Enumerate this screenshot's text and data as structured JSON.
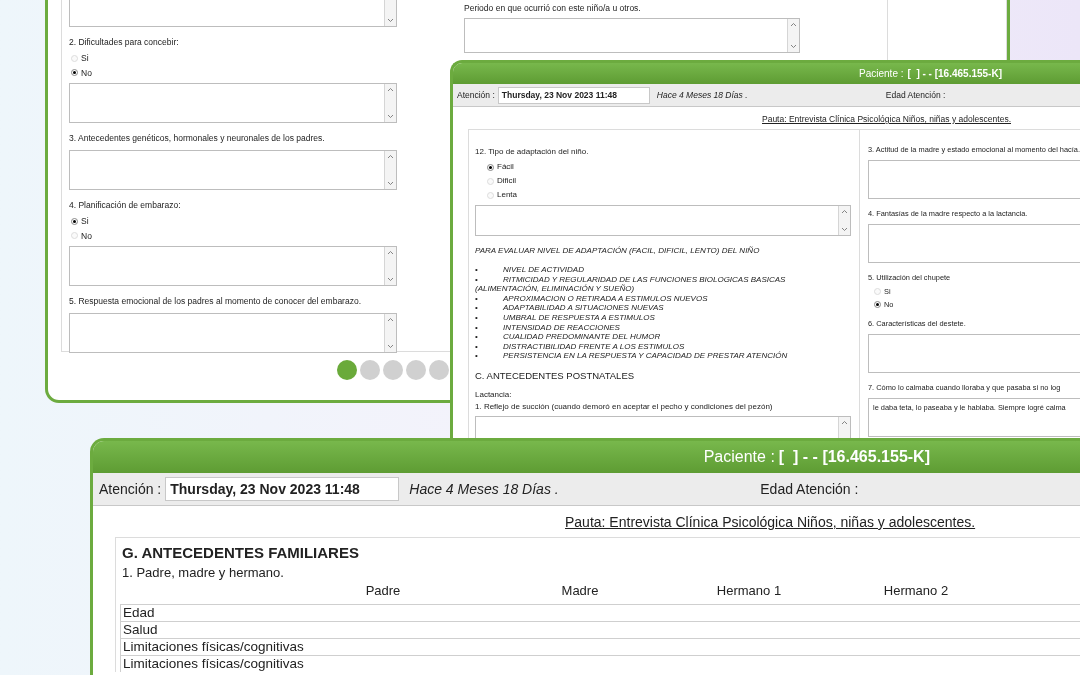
{
  "back_window": {
    "left_column": [
      {
        "kind": "textarea"
      },
      {
        "kind": "question",
        "text": "2. Dificultades para concebir:"
      },
      {
        "kind": "radio",
        "label": "Si",
        "selected": false
      },
      {
        "kind": "radio",
        "label": "No",
        "selected": true
      },
      {
        "kind": "textarea"
      },
      {
        "kind": "question",
        "text": "3. Antecedentes genéticos, hormonales y neuronales de los padres."
      },
      {
        "kind": "textarea"
      },
      {
        "kind": "question",
        "text": "4. Planificación de embarazo:"
      },
      {
        "kind": "radio",
        "label": "Si",
        "selected": true
      },
      {
        "kind": "radio",
        "label": "No",
        "selected": false
      },
      {
        "kind": "textarea"
      },
      {
        "kind": "question",
        "text": "5. Respuesta emocional de los padres  al momento de conocer del embarazo."
      },
      {
        "kind": "textarea"
      }
    ],
    "right_column": [
      {
        "kind": "question",
        "text": "Periodo en que ocurrió con este niño/a u otros."
      },
      {
        "kind": "textarea"
      }
    ],
    "pager": [
      {
        "selected": true
      },
      {
        "selected": false
      },
      {
        "selected": false
      },
      {
        "selected": false
      },
      {
        "selected": false
      }
    ]
  },
  "middle_window": {
    "header": {
      "label": "Paciente :",
      "value": "[  ] - - [16.465.155-K]"
    },
    "attention": {
      "label": "Atención :",
      "value": "Thursday, 23 Nov 2023 11:48",
      "elapsed": "Hace 4 Meses 18 Días .",
      "age_label": "Edad Atención :"
    },
    "pauta": "Pauta: Entrevista Clínica Psicológica Niños, niñas y adolescentes.",
    "left_column": [
      {
        "kind": "question",
        "text": "12. Tipo de adaptación del niño."
      },
      {
        "kind": "radio",
        "label": "Fácil",
        "selected": true
      },
      {
        "kind": "radio",
        "label": "Dificil",
        "selected": false
      },
      {
        "kind": "radio",
        "label": "Lenta",
        "selected": false
      },
      {
        "kind": "textarea"
      },
      {
        "kind": "note",
        "text": "PARA EVALUAR NIVEL DE ADAPTACIÓN (FACIL, DIFICIL,  LENTO) DEL NIÑO"
      },
      {
        "kind": "bullet",
        "marker": "•",
        "text": "NIVEL DE ACTIVIDAD"
      },
      {
        "kind": "bullet",
        "marker": "•",
        "text": "RITMICIDAD Y REGULARIDAD DE LAS FUNCIONES BIOLOGICAS BASICAS (ALIMENTACIÓN, ELIMINACIÓN Y SUEÑO)"
      },
      {
        "kind": "bullet",
        "marker": "•",
        "text": "APROXIMACION O RETIRADA A ESTIMULOS NUEVOS"
      },
      {
        "kind": "bullet",
        "marker": "•",
        "text": "ADAPTABILIDAD A SITUACIONES NUEVAS"
      },
      {
        "kind": "bullet",
        "marker": "•",
        "text": "UMBRAL DE RESPUESTA A ESTIMULOS"
      },
      {
        "kind": "bullet",
        "marker": "•",
        "text": "INTENSIDAD DE REACCIONES"
      },
      {
        "kind": "bullet",
        "marker": "•",
        "text": "CUALIDAD PREDOMINANTE DEL HUMOR"
      },
      {
        "kind": "bullet",
        "marker": "•",
        "text": "DISTRACTIBILIDAD FRENTE A LOS ESTIMULOS"
      },
      {
        "kind": "bullet",
        "marker": "•",
        "text": "PERSISTENCIA EN LA RESPUESTA Y CAPACIDAD DE PRESTAR ATENCIÓN"
      },
      {
        "kind": "heading",
        "text": "C. ANTECEDENTES POSTNATALES"
      },
      {
        "kind": "text",
        "text": "Lactancia:"
      },
      {
        "kind": "text",
        "text": "1. Reflejo de succión (cuando demoró en aceptar el pecho y condiciones del pezón)"
      },
      {
        "kind": "textarea"
      }
    ],
    "right_column": [
      {
        "kind": "question",
        "text": "3. Actitud de la madre y estado emocional al momento del hacía."
      },
      {
        "kind": "textarea"
      },
      {
        "kind": "question",
        "text": "4. Fantasías de la madre respecto a la lactancia."
      },
      {
        "kind": "textarea"
      },
      {
        "kind": "question",
        "text": "5. Utilización del chupete"
      },
      {
        "kind": "radio",
        "label": "Si",
        "selected": false
      },
      {
        "kind": "radio",
        "label": "No",
        "selected": true
      },
      {
        "kind": "question",
        "text": "6. Características del destete."
      },
      {
        "kind": "textarea"
      },
      {
        "kind": "question",
        "text": "7. Cómo lo calmaba cuando lloraba y que pasaba si no log"
      },
      {
        "kind": "textarea",
        "value": "le daba teta, lo paseaba y le hablaba. Siempre logré calma"
      }
    ]
  },
  "front_window": {
    "header": {
      "label": "Paciente :",
      "value": "[  ] - - [16.465.155-K]"
    },
    "attention": {
      "label": "Atención :",
      "value": "Thursday, 23 Nov 2023 11:48",
      "elapsed": "Hace 4 Meses 18 Días .",
      "age_label": "Edad Atención :"
    },
    "pauta": "Pauta: Entrevista Clínica Psicológica Niños, niñas y adolescentes.",
    "section_title": "G. ANTECEDENTES FAMILIARES",
    "question": "1. Padre, madre y hermano.",
    "table": {
      "columns": [
        "Padre",
        "Madre",
        "Hermano 1",
        "Hermano 2"
      ],
      "rows": [
        {
          "label": "Edad"
        },
        {
          "label": "Salud"
        },
        {
          "label": "Limitaciones físicas/cognitivas"
        },
        {
          "label": "Limitaciones físicas/cognitivas"
        }
      ]
    }
  }
}
